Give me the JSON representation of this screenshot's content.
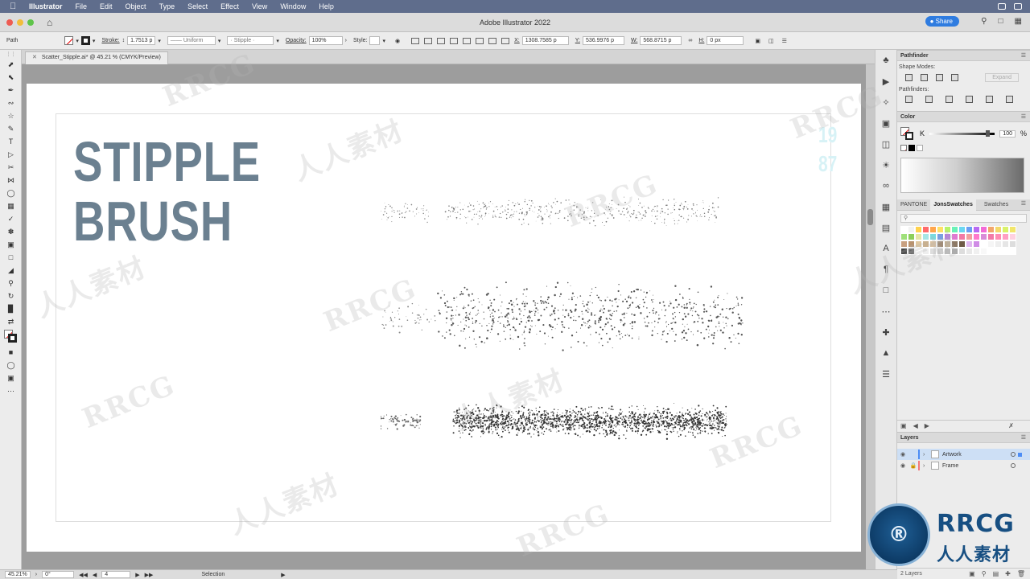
{
  "menubar": {
    "items": [
      "Illustrator",
      "File",
      "Edit",
      "Object",
      "Type",
      "Select",
      "Effect",
      "View",
      "Window",
      "Help"
    ]
  },
  "titlebar": {
    "title": "Adobe Illustrator 2022",
    "share_label": "Share"
  },
  "controlbar": {
    "selection_type": "Path",
    "stroke_label": "Stroke:",
    "stroke_value": "1.7513 p",
    "stroke_profile": "Uniform",
    "brush": "Stipple",
    "opacity_label": "Opacity:",
    "opacity_value": "100%",
    "style_label": "Style:",
    "x_label": "X:",
    "x_value": "1308.7585 p",
    "y_label": "Y:",
    "y_value": "536.9976 p",
    "w_label": "W:",
    "w_value": "568.8715 p",
    "h_label": "H:",
    "h_value": "0 px"
  },
  "document_tab": {
    "label": "Scatter_Stipple.ai* @ 45.21 % (CMYK/Preview)"
  },
  "artboard": {
    "headline_line1": "STIPPLE",
    "headline_line2": "BRUSH",
    "year_top": "19",
    "year_bottom": "87",
    "headline_color": "#6b8090",
    "year_color": "#d7f2f6"
  },
  "statusbar": {
    "zoom": "45.21%",
    "rotation": "0°",
    "artboard_number": "4",
    "tool": "Selection"
  },
  "panels": {
    "pathfinder": {
      "title": "Pathfinder",
      "shape_modes_label": "Shape Modes:",
      "pathfinders_label": "Pathfinders:",
      "expand_label": "Expand"
    },
    "color": {
      "title": "Color",
      "channel": "K",
      "value": "100",
      "unit": "%"
    },
    "swatches": {
      "tabs": [
        "PANTONE",
        "JonsSwatches",
        "Swatches"
      ],
      "active_tab": "JonsSwatches",
      "colors": [
        "#ffffff",
        "#f2f2f2",
        "#ffd24d",
        "#ff6b6b",
        "#ffa64d",
        "#ffe066",
        "#b8f26b",
        "#6bf2b8",
        "#6bd6f2",
        "#6b9ff2",
        "#b86bf2",
        "#f26bd6",
        "#f2a66b",
        "#f2d96b",
        "#d9f26b",
        "#f2e66b",
        "#9fe07a",
        "#8ccf5a",
        "#e6e6a8",
        "#a6e6e6",
        "#7adbe0",
        "#7a9fe0",
        "#b87ae0",
        "#e07ad1",
        "#f27aa6",
        "#f29f9f",
        "#ff7acc",
        "#d98cd9",
        "#f27aa8",
        "#ff8cb3",
        "#ff9fc4",
        "#ffd1e0",
        "#c8a080",
        "#b8926e",
        "#e0c8a0",
        "#c8b090",
        "#d9c0a0",
        "#a08c78",
        "#bfae94",
        "#8c7864",
        "#6e5a46",
        "#e0b8f0",
        "#d08ce6",
        "#ffffff",
        "#f5f5f5",
        "#eeeeee",
        "#e6e6e6",
        "#dddddd",
        "#444444",
        "#666666",
        "#ffffff",
        "#eeeeee",
        "#dddddd",
        "#cccccc",
        "#bbbbbb",
        "#aaaaaa",
        "#dddddd",
        "#e8e8e8",
        "#f0f0f0",
        "#f8f8f8",
        "#ffffff",
        "#ffffff",
        "#ffffff",
        "#ffffff"
      ]
    },
    "layers": {
      "title": "Layers",
      "items": [
        {
          "name": "Artwork",
          "color": "#4d8df5"
        },
        {
          "name": "Frame",
          "color": "#f27a7a"
        }
      ],
      "count_label": "2 Layers"
    }
  },
  "watermark": {
    "text_latin": "RRCG",
    "text_cjk": "人人素材",
    "logo_text": "RRCG",
    "logo_sub": "人人素材"
  }
}
